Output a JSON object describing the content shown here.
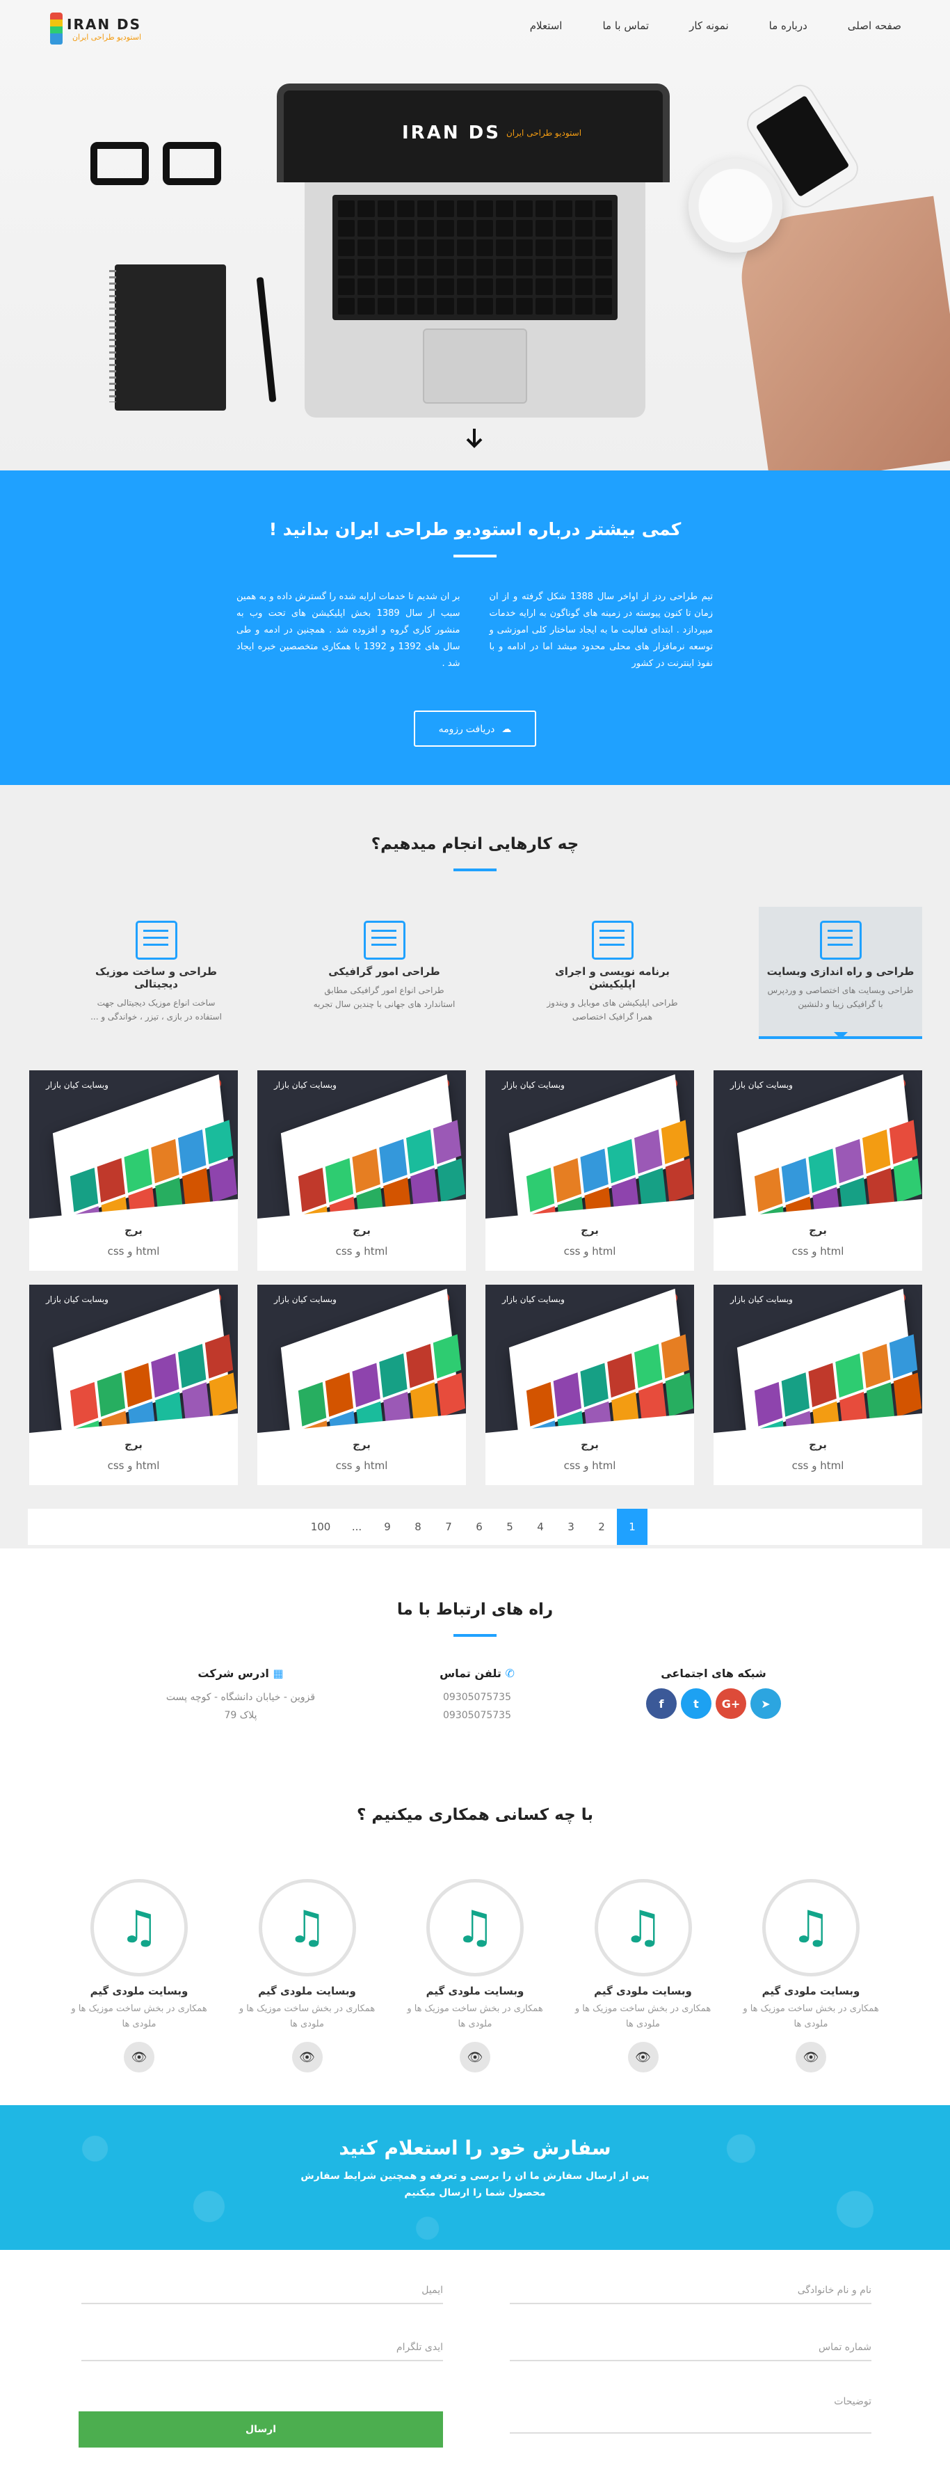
{
  "header": {
    "logo_title": "IRAN DS",
    "logo_subtitle": "استودیو طراحی ایران",
    "nav": [
      {
        "label": "صفحه اصلی"
      },
      {
        "label": "درباره ما"
      },
      {
        "label": "نمونه کار"
      },
      {
        "label": "تماس با ما"
      },
      {
        "label": "استعلام"
      }
    ]
  },
  "hero": {
    "screen_logo_title": "IRAN DS",
    "screen_logo_subtitle": "استودیو طراحی ایران",
    "scroll_icon": "arrow-down-icon"
  },
  "about": {
    "title": "کمی بیشتر درباره استودیو طراحی ایران بدانید !",
    "col_right": "تیم طراحی ردز از اواخر سال 1388 شکل گرفته و از ان زمان تا کنون پیوسته در زمینه های گوناگون به ارایه خدمات میپردازد . ابتدای فعالیت ما به ایجاد ساختار کلی اموزشی و توسعه نرمافزار های محلی محدود میشد اما در ادامه و با نفوذ اینترنت در کشور",
    "col_left": "بر ان شدیم تا خدمات ارایه شده را گسترش داده و به همین سبب از سال 1389 بخش اپلیکیشن های تحت وب به منشور کاری گروه و افزوده شد . همچنین در ادمه و طی سال های 1392 و 1392 با همکاری متخصصین خبره ایجاد شد .",
    "button_label": "دریافت رزومه",
    "button_icon": "cloud-download-icon"
  },
  "services": {
    "title": "چه کارهایی انجام میدهیم؟",
    "tabs": [
      {
        "title": "طراحی و راه اندازی وبسایت",
        "desc": "طراحی وبسایت های اختصاصی و وردپرس با گرافیکی زیبا و دلنشین"
      },
      {
        "title": "برنامه نویسی و اجرای اپلیکیشن",
        "desc": "طراحی اپلیکیشن های موبایل و ویندوز همرا گرافیک اختصاصی"
      },
      {
        "title": "طراحی امور گرافیکی",
        "desc": "طراحی انواع امور گرافیکی مطابق استاندارد های جهانی با چندین سال تجربه"
      },
      {
        "title": "طراحی و ساخت موزیک دیجیتالی",
        "desc": "ساخت انواع موزیک دیجیتالی جهت استفاده در بازی ، تیزر ، خواندگی و ..."
      }
    ],
    "cards": [
      {
        "tag": "وبسایت کیان بازار",
        "title": "برج",
        "sub": "html و css"
      },
      {
        "tag": "وبسایت کیان بازار",
        "title": "برج",
        "sub": "html و css"
      },
      {
        "tag": "وبسایت کیان بازار",
        "title": "برج",
        "sub": "html و css"
      },
      {
        "tag": "وبسایت کیان بازار",
        "title": "برج",
        "sub": "html و css"
      },
      {
        "tag": "وبسایت کیان بازار",
        "title": "برج",
        "sub": "html و css"
      },
      {
        "tag": "وبسایت کیان بازار",
        "title": "برج",
        "sub": "html و css"
      },
      {
        "tag": "وبسایت کیان بازار",
        "title": "برج",
        "sub": "html و css"
      },
      {
        "tag": "وبسایت کیان بازار",
        "title": "برج",
        "sub": "html و css"
      }
    ],
    "pagination": [
      "1",
      "2",
      "3",
      "4",
      "5",
      "6",
      "7",
      "8",
      "9",
      "...",
      "100"
    ],
    "active_page": "1",
    "accent": "#1fa1ff"
  },
  "contact": {
    "title": "راه های ارتباط با ما",
    "social_title": "شبکه های اجتماعی",
    "social": [
      {
        "icon": "facebook-icon",
        "glyph": "f",
        "color": "#3b5998"
      },
      {
        "icon": "twitter-icon",
        "glyph": "t",
        "color": "#1da1f2"
      },
      {
        "icon": "google-plus-icon",
        "glyph": "G+",
        "color": "#dd4b39"
      },
      {
        "icon": "telegram-icon",
        "glyph": "➤",
        "color": "#2ca5e0"
      }
    ],
    "phone_title": "تلفن تماس",
    "phones": [
      "09305075735",
      "09305075735"
    ],
    "address_title": "ادرس شرکت",
    "address_line1": "قزوین - خیابان دانشگاه - کوچه پست",
    "address_line2": "پلاک 79"
  },
  "partners": {
    "title": "با چه کسانی همکاری میکنیم ؟",
    "items": [
      {
        "name": "وبسایت ملودی گیم",
        "desc": "همکاری در بخش ساخت موزیک ها و ملودی ها"
      },
      {
        "name": "وبسایت ملودی گیم",
        "desc": "همکاری در بخش ساخت موزیک ها و ملودی ها"
      },
      {
        "name": "وبسایت ملودی گیم",
        "desc": "همکاری در بخش ساخت موزیک ها و ملودی ها"
      },
      {
        "name": "وبسایت ملودی گیم",
        "desc": "همکاری در بخش ساخت موزیک ها و ملودی ها"
      },
      {
        "name": "وبسایت ملودی گیم",
        "desc": "همکاری در بخش ساخت موزیک ها و ملودی ها"
      }
    ]
  },
  "cta": {
    "title": "سفارش خود را استعلام کنید",
    "text_line1": "پس از ارسال سفارش ما ان را برسی و تعرفه و همچنین شرایط سفارش",
    "text_line2": "محصول شما را ارسال میکنیم"
  },
  "form": {
    "name_placeholder": "نام و نام خانوادگی",
    "phone_placeholder": "شماره تماس",
    "desc_placeholder": "توضیحات",
    "email_placeholder": "ایمیل",
    "telegram_placeholder": "ایدی تلگرام",
    "submit_label": "ارسال",
    "submit_color": "#4cae4f"
  }
}
